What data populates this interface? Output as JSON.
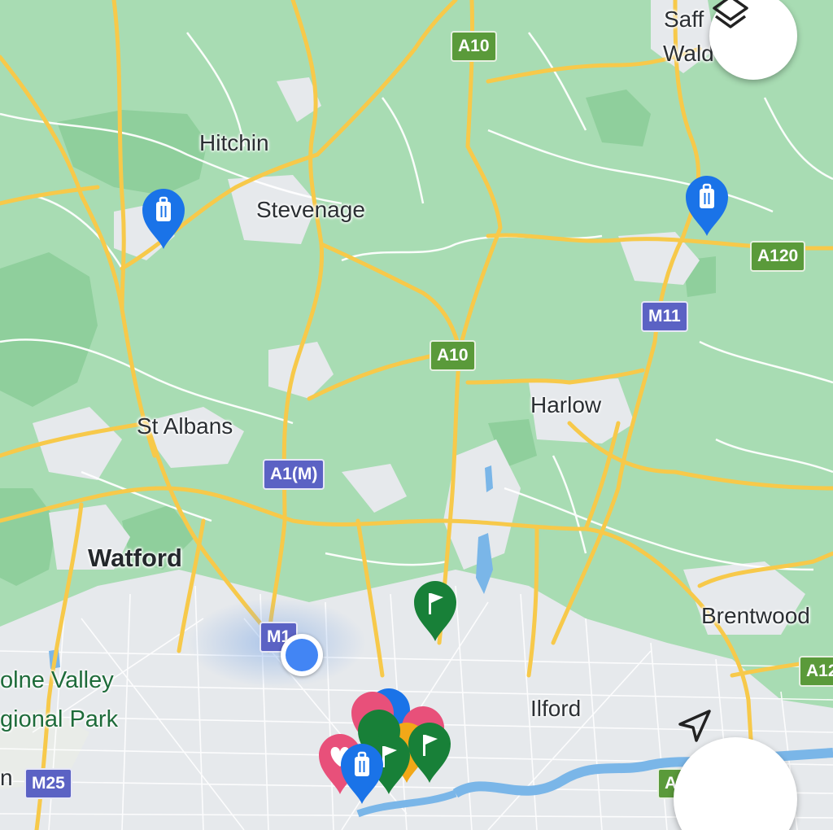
{
  "places": {
    "saffron_walden_1": "Saff",
    "saffron_walden_2": "Wald",
    "hitchin": "Hitchin",
    "stevenage": "Stevenage",
    "harlow": "Harlow",
    "st_albans": "St Albans",
    "watford": "Watford",
    "brentwood": "Brentwood",
    "ilford": "Ilford",
    "colne_valley_1": "olne Valley",
    "colne_valley_2": "gional Park",
    "edge_n": "n"
  },
  "roads": {
    "a10_north": "A10",
    "a10_mid": "A10",
    "a120": "A120",
    "m11": "M11",
    "a1m": "A1(M)",
    "m1": "M1",
    "m25": "M25",
    "a12_east": "A12",
    "a1_edge": "A"
  },
  "controls": {
    "layers_icon": "layers-icon",
    "navigate_icon": "navigation-arrow-icon"
  },
  "markers": {
    "hotel_icon": "luggage-icon",
    "flag_icon": "flag-icon",
    "heart_icon": "heart-icon",
    "current_location": "current-location-dot"
  },
  "colors": {
    "land": "#a8dcb3",
    "urban": "#e6e9ec",
    "motorway": "#f7c94a",
    "hotel_pin": "#1a73e8",
    "flag_pin": "#188038",
    "heart_pin": "#e8507a",
    "star_pin": "#f2a818",
    "location_dot": "#4285f4"
  }
}
